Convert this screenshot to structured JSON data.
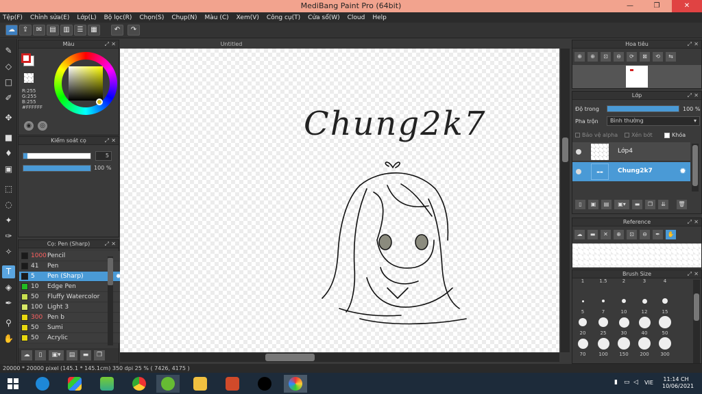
{
  "window": {
    "title": "MediBang Paint Pro (64bit)",
    "minimize": "—",
    "restore": "❐",
    "close": "✕"
  },
  "menu": [
    "Tệp(F)",
    "Chỉnh sửa(E)",
    "Lớp(L)",
    "Bộ lọc(R)",
    "Chọn(S)",
    "Chụp(N)",
    "Màu (C)",
    "Xem(V)",
    "Công cụ(T)",
    "Cửa sổ(W)",
    "Cloud",
    "Help"
  ],
  "color_panel": {
    "title": "Màu",
    "r": "R:255",
    "g": "G:255",
    "b": "B:255",
    "hex": "#FFFFFF",
    "primary": "#d22020"
  },
  "brush_control": {
    "title": "Kiểm soát cọ",
    "size": "5",
    "opacity": "100 %"
  },
  "brush_panel": {
    "title": "Cọ: Pen (Sharp)",
    "brushes": [
      {
        "size": "1000",
        "name": "Pencil",
        "color": "#1a1a1a",
        "red": true
      },
      {
        "size": "41",
        "name": "Pen",
        "color": "#1a1a1a",
        "red": false
      },
      {
        "size": "5",
        "name": "Pen (Sharp)",
        "color": "#1a1a1a",
        "red": true,
        "selected": true
      },
      {
        "size": "10",
        "name": "Edge Pen",
        "color": "#22bb22",
        "red": false
      },
      {
        "size": "50",
        "name": "Fluffy Watercolor",
        "color": "#c8e050",
        "red": false
      },
      {
        "size": "100",
        "name": "Light 3",
        "color": "#d8e868",
        "red": false
      },
      {
        "size": "300",
        "name": "Pen b",
        "color": "#e8d810",
        "red": true
      },
      {
        "size": "50",
        "name": "Sumi",
        "color": "#e8d810",
        "red": false
      },
      {
        "size": "50",
        "name": "Acrylic",
        "color": "#e8d810",
        "red": false
      }
    ]
  },
  "canvas": {
    "tab": "Untitled",
    "text": "Chung2k7"
  },
  "navigator": {
    "title": "Hoa tiêu"
  },
  "layer_panel": {
    "title": "Lớp",
    "opacity_label": "Độ trong",
    "opacity_value": "100 %",
    "blend_label": "Pha trộn",
    "blend_value": "Bình thường",
    "protect_alpha": "Bảo vệ alpha",
    "clipping": "Xén bớt",
    "lock": "Khóa",
    "layers": [
      {
        "name": "Lớp4",
        "selected": false
      },
      {
        "name": "Chung2k7",
        "selected": true
      }
    ]
  },
  "reference": {
    "title": "Reference"
  },
  "brush_size": {
    "title": "Brush Size",
    "sizes": [
      "1",
      "1.5",
      "2",
      "3",
      "4",
      "5",
      "7",
      "10",
      "12",
      "15",
      "20",
      "25",
      "30",
      "40",
      "50",
      "70",
      "100",
      "150",
      "200",
      "300"
    ]
  },
  "status": {
    "text": "20000 * 20000 pixel  (145.1 * 145.1cm)  350 dpi  25 %  ( 7426, 4175 )"
  },
  "taskbar": {
    "lang": "VIE",
    "time": "11:14 CH",
    "date": "10/06/2021"
  }
}
